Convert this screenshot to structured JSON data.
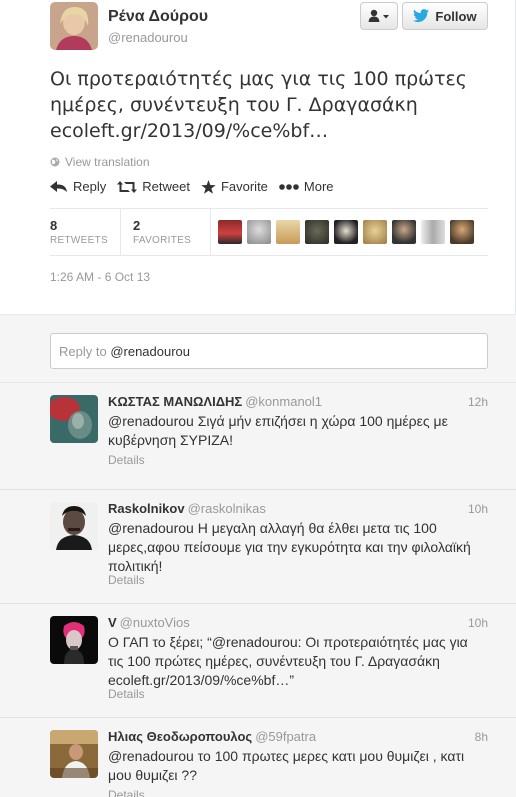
{
  "main_tweet": {
    "fullname": "Ρένα Δούρου",
    "username": "@renadourou",
    "follow_label": "Follow",
    "text_lines": [
      "Οι προτεραιότητές μας για τις 100 πρώτες",
      "ημέρες, συνέντευξη του Γ. Δραγασάκη",
      "ecoleft.gr/2013/09/%ce%bf…"
    ],
    "view_translation": "View translation",
    "actions": {
      "reply": "Reply",
      "retweet": "Retweet",
      "favorite": "Favorite",
      "more": "More"
    },
    "stats": {
      "retweets_count": "8",
      "retweets_label": "RETWEETS",
      "favorites_count": "2",
      "favorites_label": "FAVORITES"
    },
    "timestamp": "1:26 AM - 6 Oct 13"
  },
  "reply_box": {
    "prefix": "Reply to ",
    "mention": "@renadourou"
  },
  "replies": [
    {
      "name": "ΚΩΣΤΑΣ ΜΑΝΩΛΙΔΗΣ",
      "handle": "@konmanol1",
      "time": "12h",
      "text": "@renadourou Σιγά μήν επιζήσει η χώρα 100 ημέρες με κυβέρνηση ΣΥΡΙΖΑ!",
      "details": "Details"
    },
    {
      "name": "Raskolnikov",
      "handle": "@raskolnikas",
      "time": "10h",
      "text": "@renadourou Η μεγαλη αλλαγή θα έλθει μετα τις 100 μερες,αφου πείσουμε για την εγκυρότητα και την φιλολαϊκή πολιτική!",
      "details": "Details"
    },
    {
      "name": "V",
      "handle": "@nuxtoVios",
      "time": "10h",
      "text": "Ο ΓΑΠ το ξέρει; “@renadourou: Οι προτεραιότητές μας για τις 100 πρώτες ημέρες, συνέντευξη του Γ. Δραγασάκη ecoleft.gr/2013/09/%ce%bf…”",
      "details": "Details"
    },
    {
      "name": "Ηλιας Θεοδωροπουλος",
      "handle": "@59fpatra",
      "time": "8h",
      "text": "@renadourou το 100 πρωτες μερες κατι μου θυμιζει , κατι μου θυμιζει ??",
      "details": "Details"
    }
  ],
  "colors": {
    "follow_blue": "#2aa9e0",
    "secondary_text": "#999999",
    "reply_background": "#f5f5f5"
  }
}
